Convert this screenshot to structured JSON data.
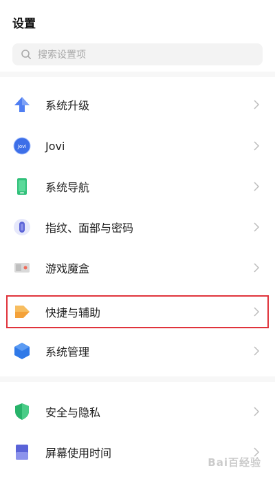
{
  "header": {
    "title": "设置"
  },
  "search": {
    "placeholder": "搜索设置项"
  },
  "items": [
    {
      "label": "系统升级",
      "icon": "arrow-up-icon"
    },
    {
      "label": "Jovi",
      "icon": "jovi-icon"
    },
    {
      "label": "系统导航",
      "icon": "phone-icon"
    },
    {
      "label": "指纹、面部与密码",
      "icon": "fingerprint-icon"
    },
    {
      "label": "游戏魔盒",
      "icon": "game-box-icon"
    },
    {
      "label": "快捷与辅助",
      "icon": "shortcut-icon"
    },
    {
      "label": "系统管理",
      "icon": "hexagon-icon"
    },
    {
      "label": "安全与隐私",
      "icon": "shield-icon"
    },
    {
      "label": "屏幕使用时间",
      "icon": "hourglass-icon"
    }
  ],
  "watermark": "Bai百经验",
  "colors": {
    "highlight": "#e0333b",
    "accent": "#4a7cf0"
  }
}
